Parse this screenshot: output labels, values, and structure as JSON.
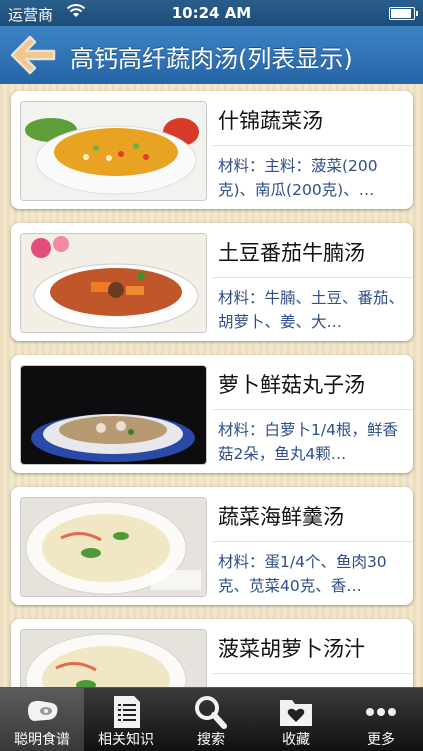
{
  "status_bar": {
    "carrier": "运营商",
    "time": "10:24 AM",
    "wifi_icon": "wifi-icon",
    "battery_icon": "battery-icon"
  },
  "nav": {
    "title": "高钙高纤蔬肉汤(列表显示)",
    "back_icon": "back-arrow-icon"
  },
  "recipes": [
    {
      "title": "什锦蔬菜汤",
      "ingredients": "材料：主料：菠菜(200克)、南瓜(200克)、…"
    },
    {
      "title": "土豆番茄牛腩汤",
      "ingredients": "材料：牛腩、土豆、番茄、胡萝卜、姜、大…"
    },
    {
      "title": "萝卜鲜菇丸子汤",
      "ingredients": "材料：白萝卜1/4根，鲜香菇2朵，鱼丸4颗…"
    },
    {
      "title": "蔬菜海鲜羹汤",
      "ingredients": "材料：蛋1/4个、鱼肉30克、苋菜40克、香…"
    },
    {
      "title": "菠菜胡萝卜汤汁",
      "ingredients": ""
    }
  ],
  "tabs": [
    {
      "label": "聪明食谱",
      "icon": "meat-icon",
      "active": true
    },
    {
      "label": "相关知识",
      "icon": "document-icon",
      "active": false
    },
    {
      "label": "搜索",
      "icon": "search-icon",
      "active": false
    },
    {
      "label": "收藏",
      "icon": "heart-folder-icon",
      "active": false
    },
    {
      "label": "更多",
      "icon": "more-dots-icon",
      "active": false
    }
  ],
  "colors": {
    "nav_blue": "#2f74b7",
    "ingredient_text": "#2f4f88",
    "background": "#efe4c6"
  }
}
